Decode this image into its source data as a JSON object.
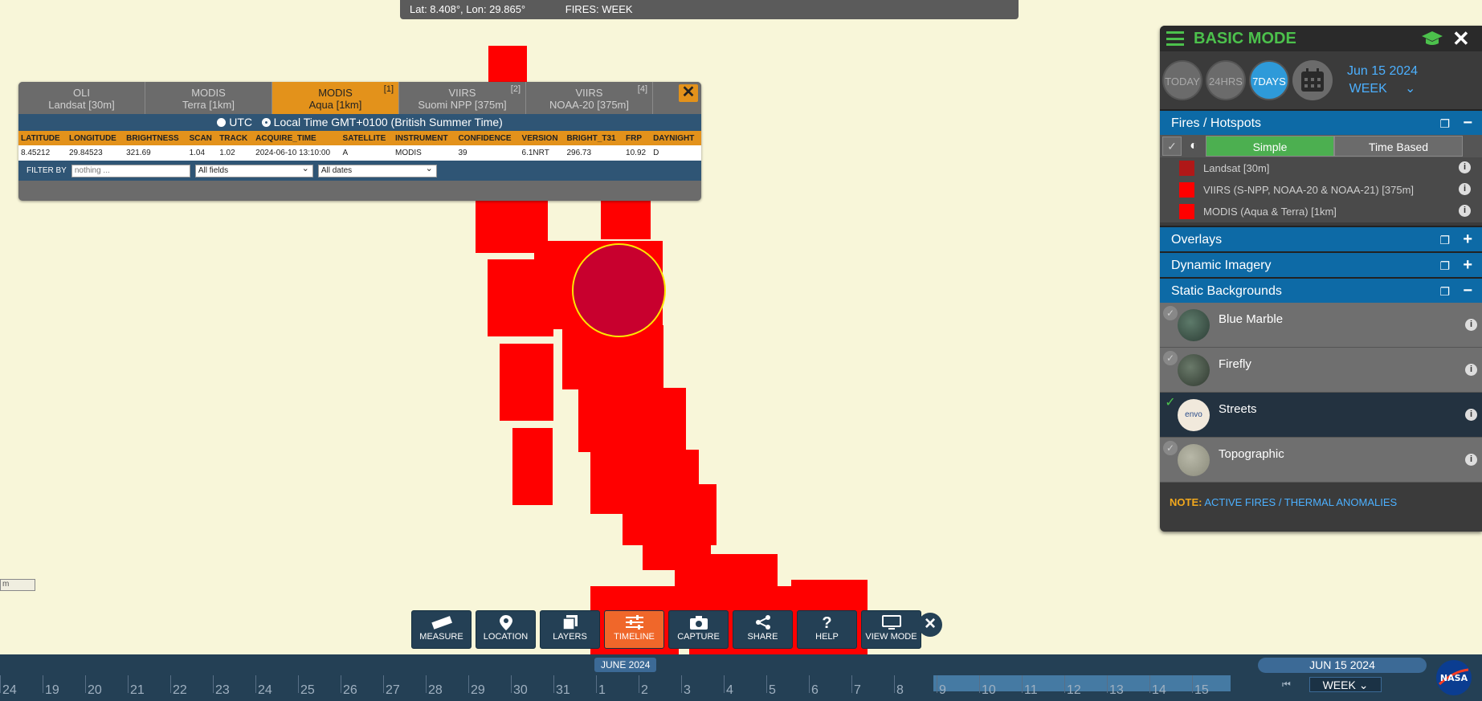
{
  "coordbar": {
    "latlon": "Lat: 8.408°, Lon: 29.865°",
    "fires": "FIRES: WEEK"
  },
  "popup": {
    "tabs": [
      {
        "line1": "OLI",
        "line2": "Landsat [30m]",
        "count": ""
      },
      {
        "line1": "MODIS",
        "line2": "Terra [1km]",
        "count": ""
      },
      {
        "line1": "MODIS",
        "line2": "Aqua [1km]",
        "count": "[1]"
      },
      {
        "line1": "VIIRS",
        "line2": "Suomi NPP [375m]",
        "count": "[2]"
      },
      {
        "line1": "VIIRS",
        "line2": "NOAA-20 [375m]",
        "count": "[4]"
      }
    ],
    "close": "✕",
    "utc_label": "UTC",
    "local_label": "Local Time GMT+0100 (British Summer Time)",
    "columns": [
      "LATITUDE",
      "LONGITUDE",
      "BRIGHTNESS",
      "SCAN",
      "TRACK",
      "ACQUIRE_TIME",
      "SATELLITE",
      "INSTRUMENT",
      "CONFIDENCE",
      "VERSION",
      "BRIGHT_T31",
      "FRP",
      "DAYNIGHT"
    ],
    "row": [
      "8.45212",
      "29.84523",
      "321.69",
      "1.04",
      "1.02",
      "2024-06-10 13:10:00",
      "A",
      "MODIS",
      "39",
      "6.1NRT",
      "296.73",
      "10.92",
      "D"
    ],
    "filter_label": "FILTER BY",
    "filter_placeholder": "nothing ...",
    "fields_select": "All fields",
    "dates_select": "All dates"
  },
  "panel": {
    "title": "BASIC MODE",
    "time_buttons": [
      "TODAY",
      "24HRS",
      "7DAYS"
    ],
    "date": "Jun 15 2024",
    "period": "WEEK",
    "sections": {
      "fires": "Fires / Hotspots",
      "overlays": "Overlays",
      "dynamic": "Dynamic Imagery",
      "static": "Static Backgrounds"
    },
    "modes": [
      "Simple",
      "Time Based"
    ],
    "fire_layers": [
      {
        "label": "Landsat [30m]",
        "color": "#b01818"
      },
      {
        "label": "VIIRS (S-NPP, NOAA-20 & NOAA-21) [375m]",
        "color": "#ff0000"
      },
      {
        "label": "MODIS (Aqua & Terra) [1km]",
        "color": "#ff0000"
      }
    ],
    "backgrounds": [
      "Blue Marble",
      "Firefly",
      "Streets",
      "Topographic"
    ],
    "streets_thumb_text": "envo",
    "note_label": "NOTE:",
    "note_text": "ACTIVE FIRES / THERMAL ANOMALIES"
  },
  "toolbar": [
    "MEASURE",
    "LOCATION",
    "LAYERS",
    "TIMELINE",
    "CAPTURE",
    "SHARE",
    "HELP",
    "VIEW MODE"
  ],
  "timeline": {
    "month": "JUNE 2024",
    "days": [
      "24",
      "19",
      "20",
      "21",
      "22",
      "23",
      "24",
      "25",
      "26",
      "27",
      "28",
      "29",
      "30",
      "31",
      "1",
      "2",
      "3",
      "4",
      "5",
      "6",
      "7",
      "8",
      "9",
      "10",
      "11",
      "12",
      "13",
      "14",
      "15"
    ],
    "current_date": "JUN 15 2024",
    "period": "WEEK"
  },
  "scale_label": "m",
  "colors": {
    "fire": "#ff0000",
    "accent": "#e3921b",
    "brand_green": "#4cc14c",
    "blue": "#0d6aa6"
  }
}
